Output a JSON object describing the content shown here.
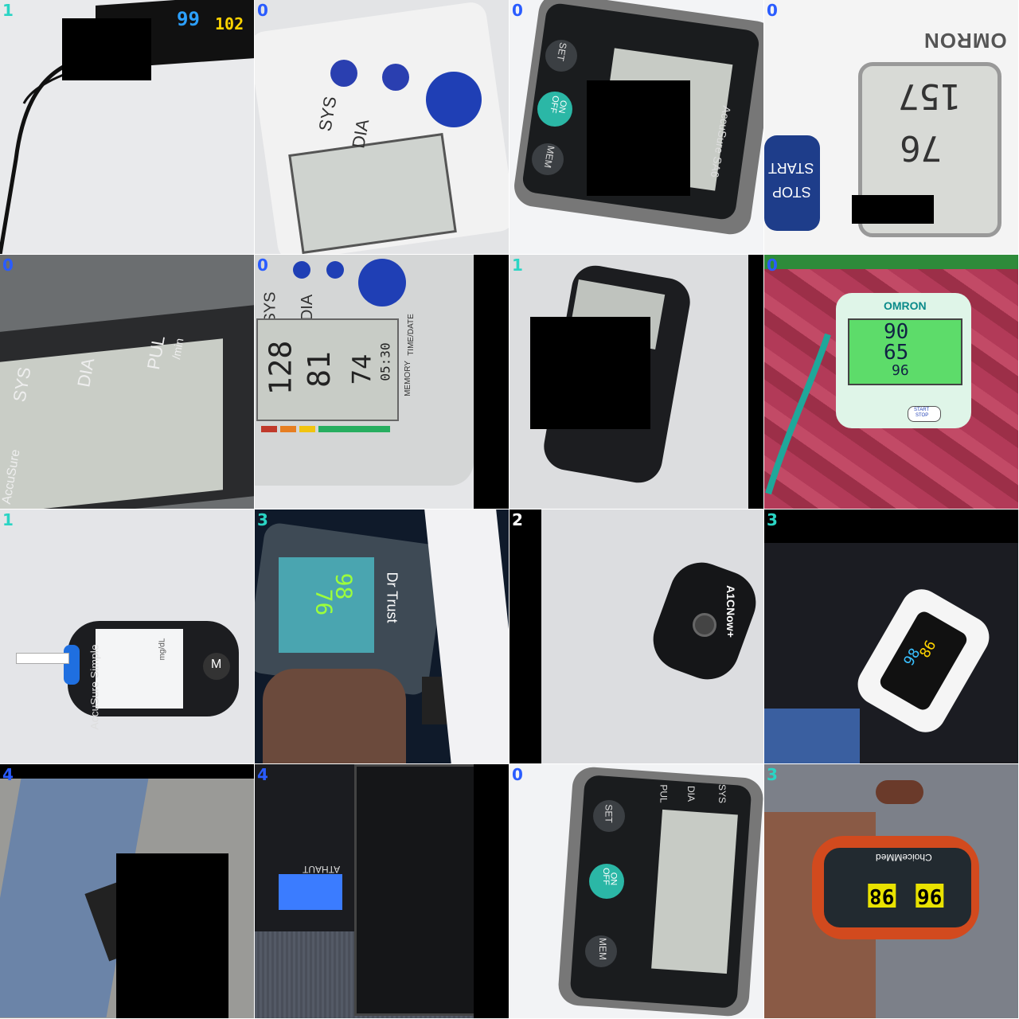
{
  "tiles": [
    {
      "label": "1",
      "color": "#2ad4c4",
      "readout": [
        "99",
        "102"
      ]
    },
    {
      "label": "0",
      "color": "#2a5cff",
      "readout": [
        "SYS",
        "DIA"
      ]
    },
    {
      "label": "0",
      "color": "#2a5cff",
      "readout": [
        "SET",
        "OFF",
        "ON",
        "MEM",
        "AccuSure SA6"
      ]
    },
    {
      "label": "0",
      "color": "#2a5cff",
      "readout": [
        "OMRON",
        "START",
        "STOP",
        "157",
        "76"
      ]
    },
    {
      "label": "0",
      "color": "#2a5cff",
      "readout": [
        "SYS",
        "DIA",
        "PUL",
        "/min",
        "AccuSure"
      ]
    },
    {
      "label": "0",
      "color": "#2a5cff",
      "readout": [
        "SYS",
        "DIA",
        "128",
        "81",
        "74",
        "05:30",
        "MEMORY",
        "TIME/DATE"
      ]
    },
    {
      "label": "1",
      "color": "#2ad4c4",
      "readout": []
    },
    {
      "label": "0",
      "color": "#2a5cff",
      "readout": [
        "OMRON",
        "90",
        "65",
        "96",
        "START",
        "STOP"
      ]
    },
    {
      "label": "1",
      "color": "#2ad4c4",
      "readout": [
        "AccuSure Simple",
        "mg/dL",
        "M"
      ]
    },
    {
      "label": "3",
      "color": "#2ad4c4",
      "readout": [
        "Dr Trust",
        "98",
        "76"
      ]
    },
    {
      "label": "2",
      "color": "#ffffff",
      "readout": [
        "A1CNow+"
      ]
    },
    {
      "label": "3",
      "color": "#2ad4c4",
      "readout": [
        "98",
        "86"
      ]
    },
    {
      "label": "4",
      "color": "#2a5cff",
      "readout": []
    },
    {
      "label": "4",
      "color": "#2a5cff",
      "readout": [
        "ATHAUT"
      ]
    },
    {
      "label": "0",
      "color": "#2a5cff",
      "readout": [
        "SET",
        "OFF",
        "ON",
        "MEM",
        "SYS",
        "DIA",
        "PUL"
      ]
    },
    {
      "label": "3",
      "color": "#2ad4c4",
      "readout": [
        "ChoiceMMed",
        "96",
        "98"
      ]
    }
  ]
}
